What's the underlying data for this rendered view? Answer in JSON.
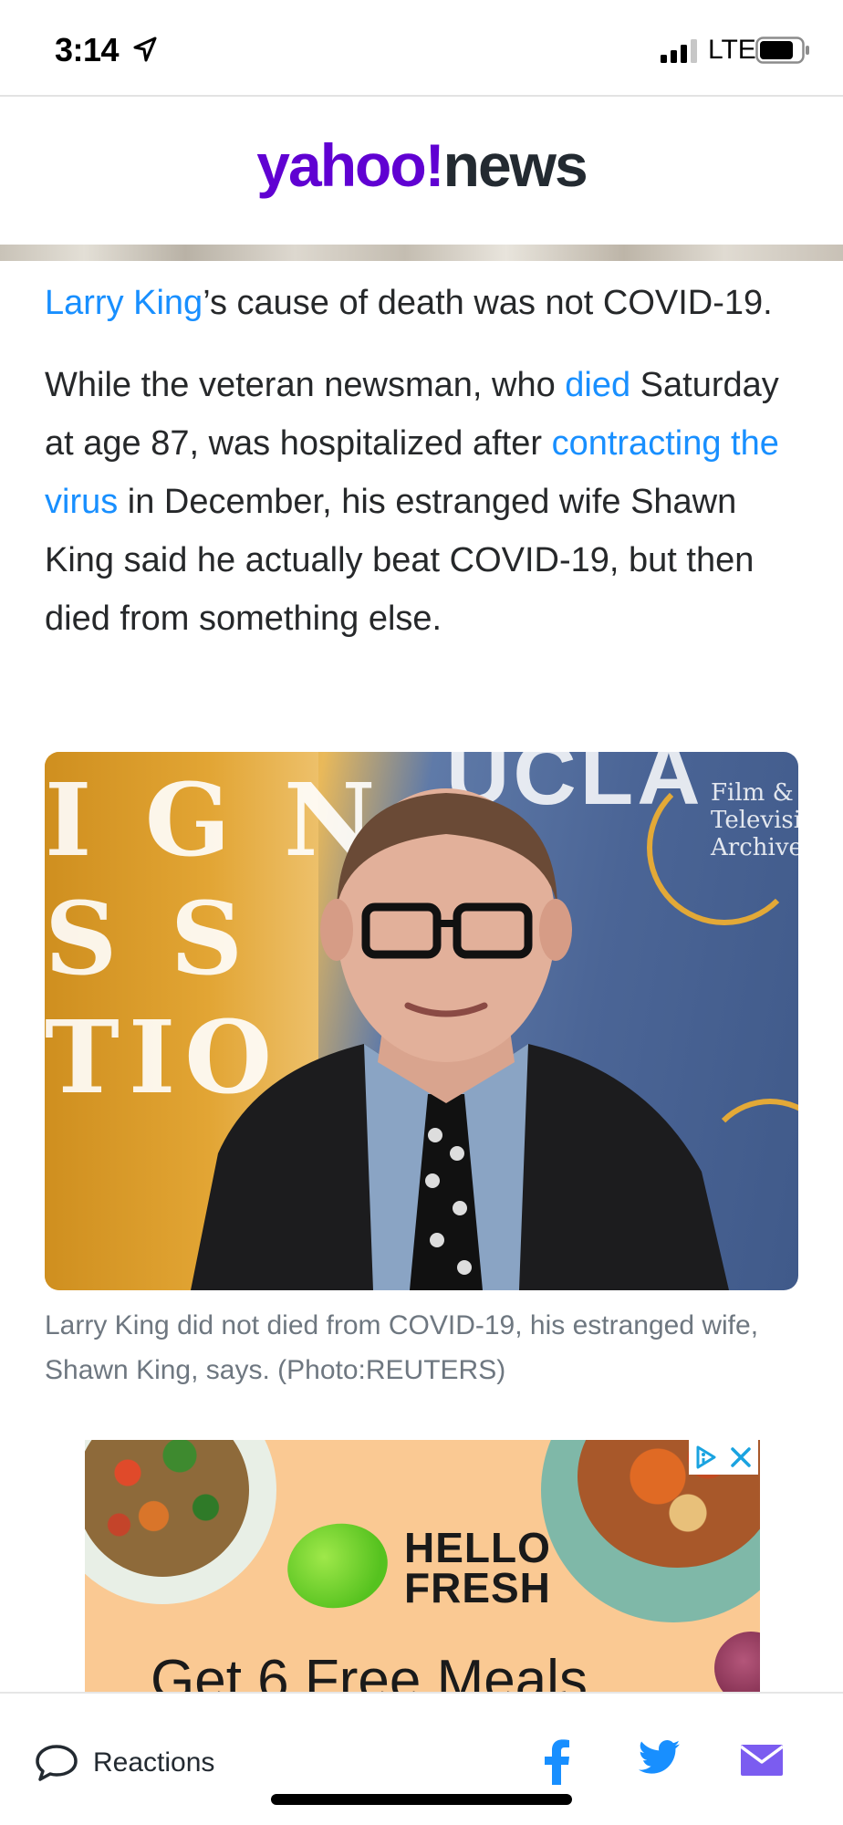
{
  "status_bar": {
    "time": "3:14",
    "network": "LTE",
    "icons": [
      "location-arrow-icon",
      "signal-bars-icon",
      "battery-icon"
    ]
  },
  "header": {
    "logo_yahoo": "yahoo!",
    "logo_news": "news",
    "brand_color": "#6001d2"
  },
  "article": {
    "para1": {
      "link": "Larry King",
      "rest": "’s cause of death was not COVID-19."
    },
    "para2": {
      "t1": "While the veteran newsman, who ",
      "link1": "died",
      "t2": " Saturday at age 87, was hospitalized after ",
      "link2": "contracting the virus",
      "t3": " in December, his estranged wife Shawn King said he actually beat COVID-19, but then died from something else."
    },
    "link_color": "#188fff"
  },
  "photo": {
    "sign_letters": "I G N\nS S\nTIO",
    "backdrop_text": "UCLA",
    "side_text": "Film &\nTelevision\nArchive"
  },
  "caption": "Larry King did not died from COVID-19, his estranged wife, Shawn King, says. (Photo:REUTERS)",
  "ad": {
    "brand": "HELLO\nFRESH",
    "headline": "Get 6 Free Meals",
    "icons": [
      "adchoices-icon",
      "close-icon"
    ]
  },
  "bottom_bar": {
    "reactions_label": "Reactions",
    "share_icons": [
      "facebook-icon",
      "twitter-icon",
      "mail-icon"
    ],
    "share_color": "#188fff",
    "mail_color": "#7b5cf0"
  }
}
